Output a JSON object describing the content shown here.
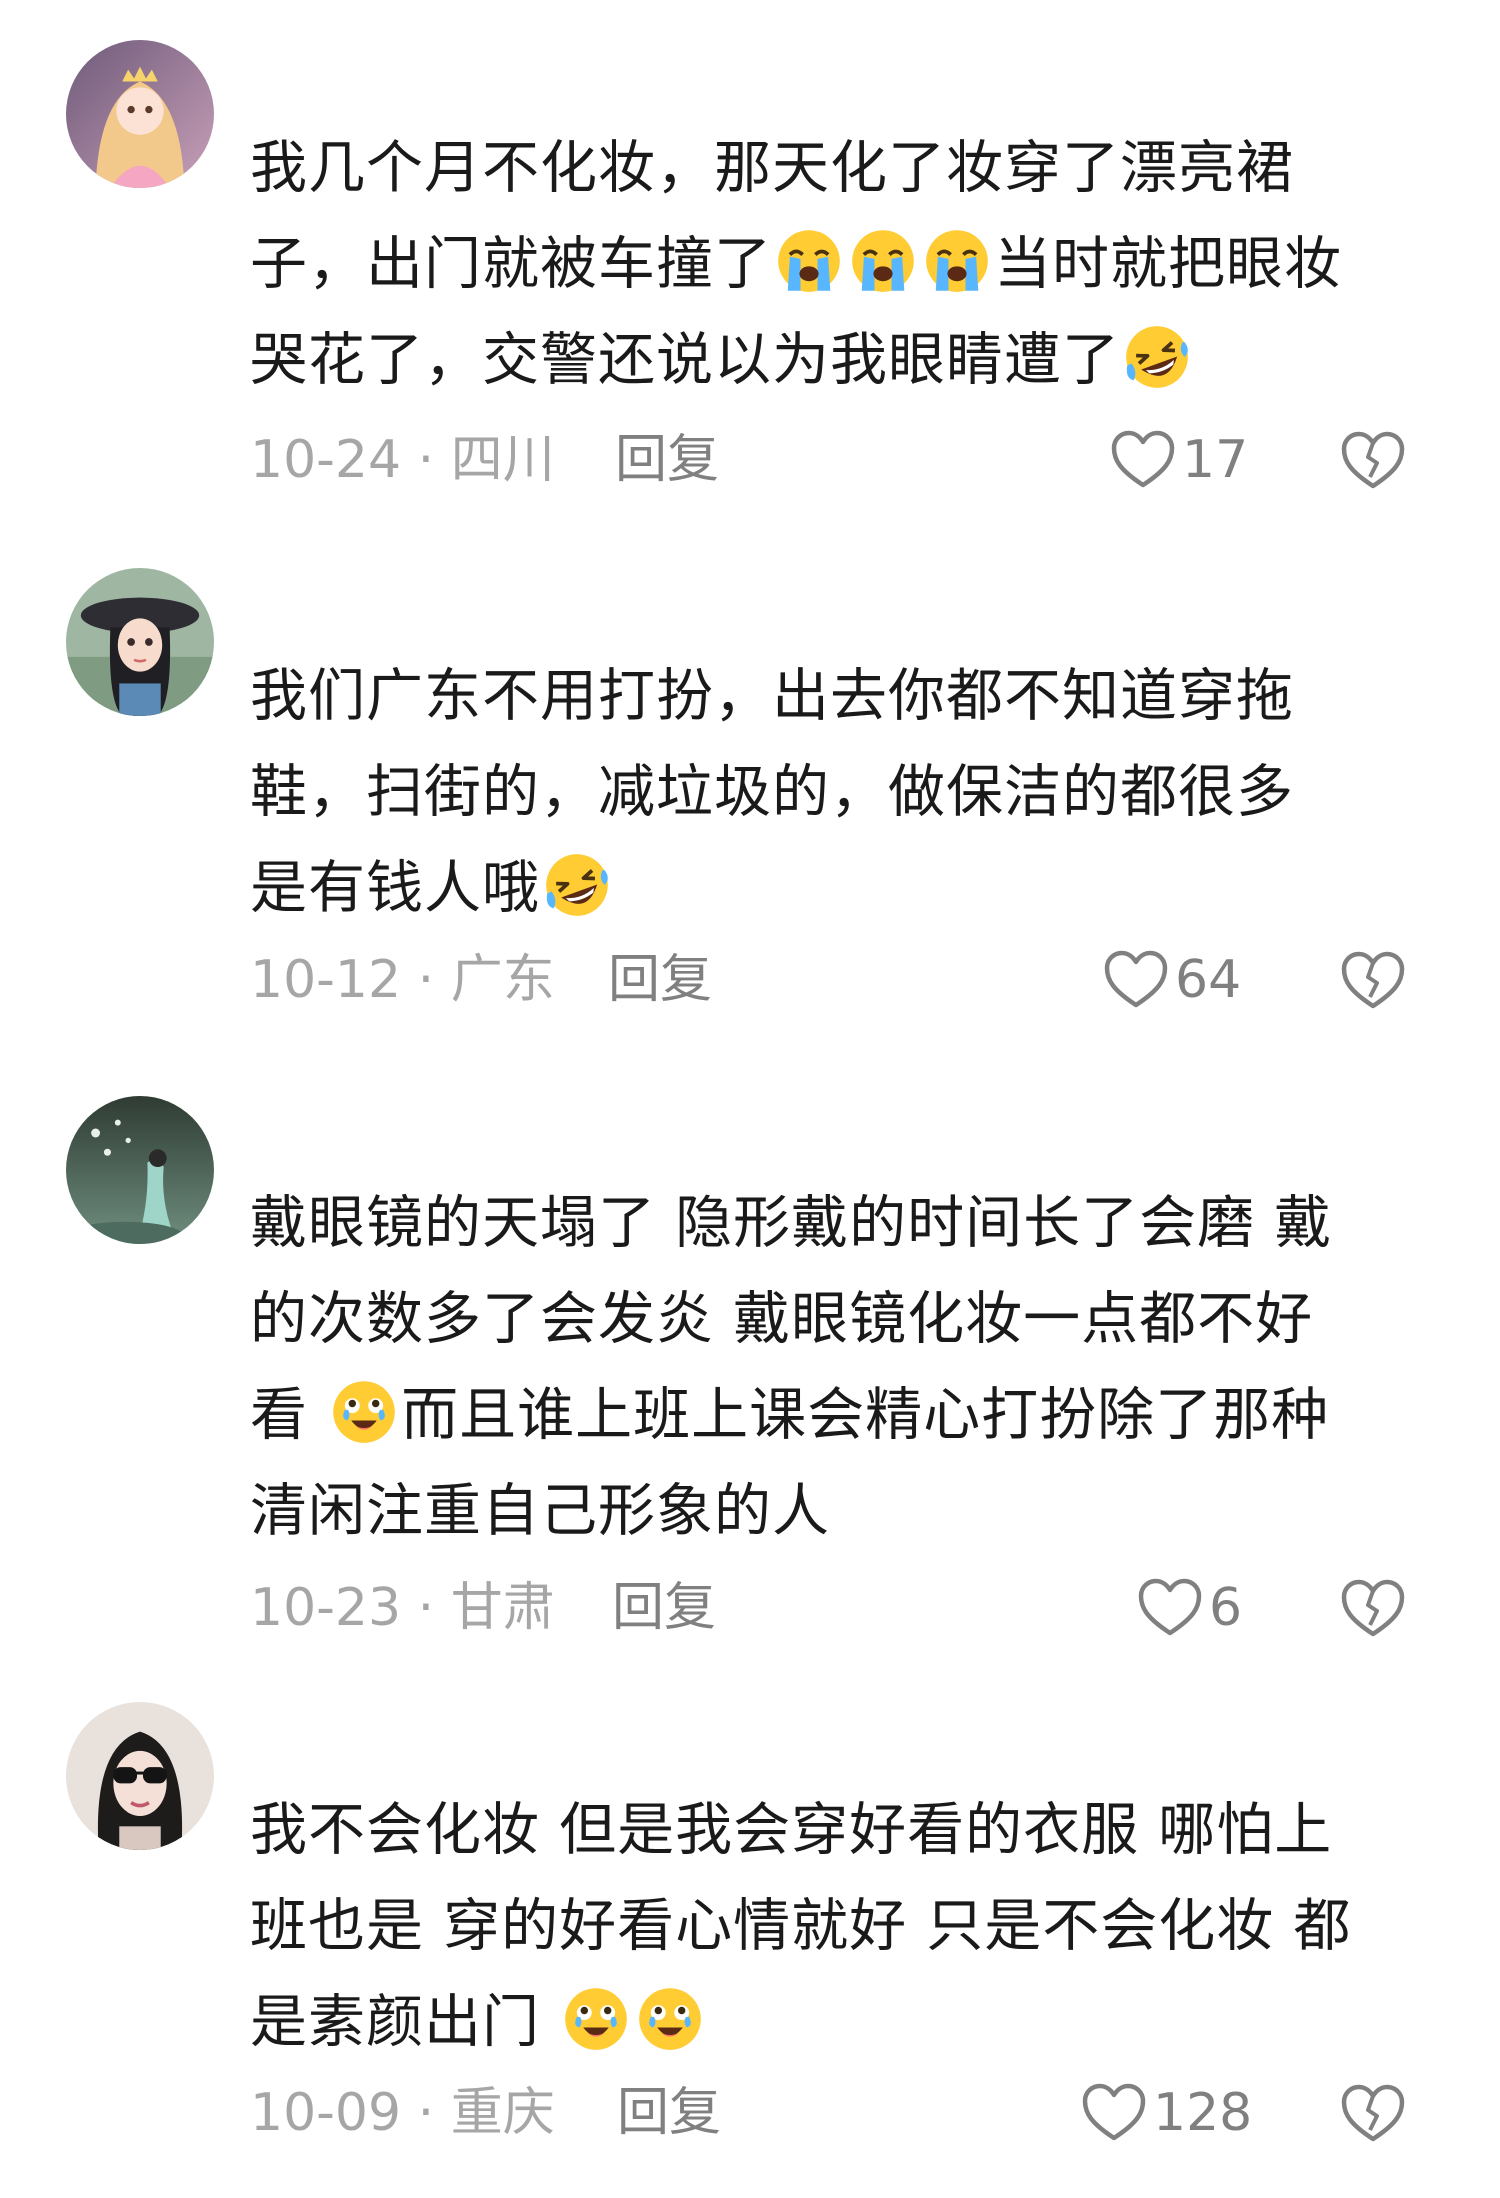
{
  "comments": [
    {
      "avatar_icon": "princess-avatar-icon",
      "lines": [
        [
          {
            "t": "我几个月不化妆，那天化了妆穿了漂亮裙"
          }
        ],
        [
          {
            "t": "子，出门就被车撞了"
          },
          {
            "e": "loudly-crying-face-icon"
          },
          {
            "e": "loudly-crying-face-icon"
          },
          {
            "e": "loudly-crying-face-icon"
          },
          {
            "t": "当时就把眼妆"
          }
        ],
        [
          {
            "t": "哭花了，交警还说以为我眼睛遭了"
          },
          {
            "e": "rolling-laughing-face-icon"
          }
        ]
      ],
      "date": "10-24 · 四川",
      "reply": "回复",
      "likes": "17"
    },
    {
      "avatar_icon": "girl-hat-avatar-icon",
      "lines": [
        [
          {
            "t": "我们广东不用打扮，出去你都不知道穿拖"
          }
        ],
        [
          {
            "t": "鞋，扫街的，减垃圾的，做保洁的都很多"
          }
        ],
        [
          {
            "t": "是有钱人哦"
          },
          {
            "e": "rolling-laughing-face-icon"
          }
        ]
      ],
      "date": "10-12 · 广东",
      "reply": "回复",
      "likes": "64"
    },
    {
      "avatar_icon": "forest-avatar-icon",
      "lines": [
        [
          {
            "t": "戴眼镜的天塌了 隐形戴的时间长了会磨 戴"
          }
        ],
        [
          {
            "t": "的次数多了会发炎 戴眼镜化妆一点都不好"
          }
        ],
        [
          {
            "t": "看 "
          },
          {
            "e": "tearful-joy-face-icon"
          },
          {
            "t": "而且谁上班上课会精心打扮除了那种"
          }
        ],
        [
          {
            "t": "清闲注重自己形象的人"
          }
        ]
      ],
      "date": "10-23 · 甘肃",
      "reply": "回复",
      "likes": "6"
    },
    {
      "avatar_icon": "sunglasses-avatar-icon",
      "lines": [
        [
          {
            "t": "我不会化妆 但是我会穿好看的衣服 哪怕上"
          }
        ],
        [
          {
            "t": "班也是 穿的好看心情就好 只是不会化妆 都"
          }
        ],
        [
          {
            "t": "是素颜出门 "
          },
          {
            "e": "tearful-joy-face-icon"
          },
          {
            "e": "tearful-joy-face-icon"
          }
        ]
      ],
      "date": "10-09 · 重庆",
      "reply": "回复",
      "likes": "128"
    }
  ],
  "colors": {
    "text": "#1a1a1a",
    "meta": "#a6a6a6",
    "icon": "#808080"
  }
}
